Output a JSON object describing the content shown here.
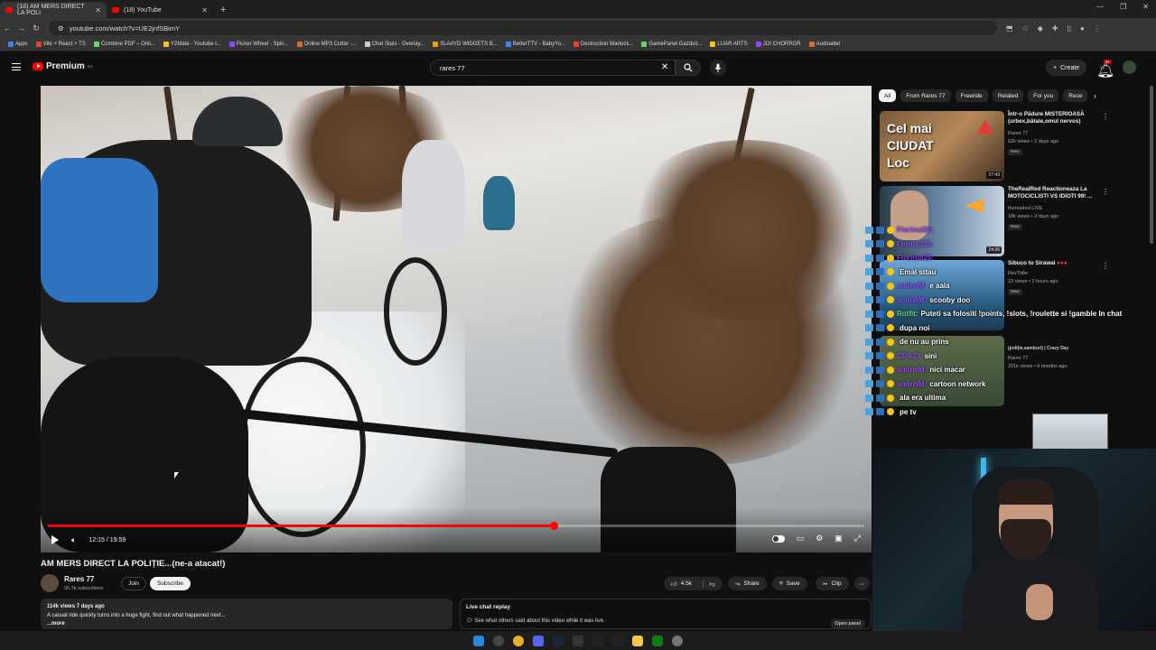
{
  "browser": {
    "tabs": [
      {
        "label": "(18) AM MERS DIRECT LA POLI",
        "active": true
      },
      {
        "label": "(18) YouTube",
        "active": false
      }
    ],
    "new_tab": "+",
    "url": "youtube.com/watch?v=UE2jnfSBimY",
    "bookmarks": [
      "Apps",
      "Vite + React + TS",
      "Combine PDF – Onli...",
      "Y2Mate - Youtube t...",
      "Picker Wheel - Spin...",
      "Online MP3 Cutter -...",
      "Chat Stats - Overlay...",
      "SLAAYD WIDGETS B...",
      "BetterTTV - BabyYo...",
      "Destruction Warlock...",
      "GamePanel Gazduir...",
      "LUAR ARTS",
      "JOI CHORROR",
      "Audioalter"
    ]
  },
  "header": {
    "logo_text": "Premium",
    "logo_sup": "RO",
    "search_value": "rares 77",
    "create_label": "Create",
    "notif_count": "9+"
  },
  "player": {
    "time": "12:15 / 19:59",
    "progress": 0.62
  },
  "video": {
    "title": "AM MERS DIRECT LA POLIȚIE...(ne-a atacat!)",
    "channel": "Rares 77",
    "subscribers": "95.7k subscribers",
    "join_label": "Join",
    "subscribe_label": "Subscribe",
    "likes": "4.5k",
    "share_label": "Share",
    "save_label": "Save",
    "clip_label": "Clip",
    "views_line": "114k views  7 days ago",
    "description": "A casual ride quickly turns into a huge fight, find out what happened next...",
    "more_label": "...more"
  },
  "live_chat": {
    "title": "Live chat replay",
    "subtitle": "See what others said about this video while it was live.",
    "open_label": "Open panel"
  },
  "chips": [
    "All",
    "From Rares 77",
    "Freeride",
    "Related",
    "For you",
    "Rece"
  ],
  "recommendations": [
    {
      "title": "Într-o Pădure MISTERIOASĂ (urbex,bătaie,omul nervos)",
      "channel": "Rares 77",
      "views": "62k views • 2 days ago",
      "badge": "New",
      "duration": "17:43",
      "thumb_text": "Cel mai CIUDAT Loc"
    },
    {
      "title": "TheRealRed Reactioneaza La MOTOCICLISTI VS IDIOTI 99! ...",
      "channel": "therealred LIVE",
      "views": "18k views • 3 days ago",
      "badge": "New",
      "duration": "24:36",
      "thumb_text": ""
    },
    {
      "title": "Sibuco to Sirawai",
      "channel": "RevTribe",
      "views": "13 views • 2 hours ago",
      "badge": "New",
      "duration": "",
      "thumb_text": ""
    },
    {
      "title": "(poliție,samburi) | Crazy Day",
      "channel": "Rares 77",
      "views": "201k views • 6 months ago",
      "badge": "",
      "duration": "",
      "thumb_text": ""
    }
  ],
  "chat_overlay": [
    {
      "nick": "Florinul25:",
      "msg": ""
    },
    {
      "nick": "Florinul25:",
      "msg": ""
    },
    {
      "nick": "Florinul25:",
      "msg": ""
    },
    {
      "nick": "",
      "msg": "Emal sttau"
    },
    {
      "nick": "andreiM:",
      "msg": "e aala"
    },
    {
      "nick": "andreiM:",
      "msg": "scooby doo"
    },
    {
      "nick": "Rotfit:",
      "msg": "Puteti sa folositi !points, !slots, !roulette si !gamble In chat"
    },
    {
      "nick": "",
      "msg": "dupa noi"
    },
    {
      "nick": "",
      "msg": "de nu au prins"
    },
    {
      "nick": "CRAZY",
      "msg": "sini"
    },
    {
      "nick": "andreiM:",
      "msg": "nici macar"
    },
    {
      "nick": "andreiM:",
      "msg": "cartoon network"
    },
    {
      "nick": "",
      "msg": "ala era ultima"
    },
    {
      "nick": "",
      "msg": "pe tv"
    }
  ]
}
